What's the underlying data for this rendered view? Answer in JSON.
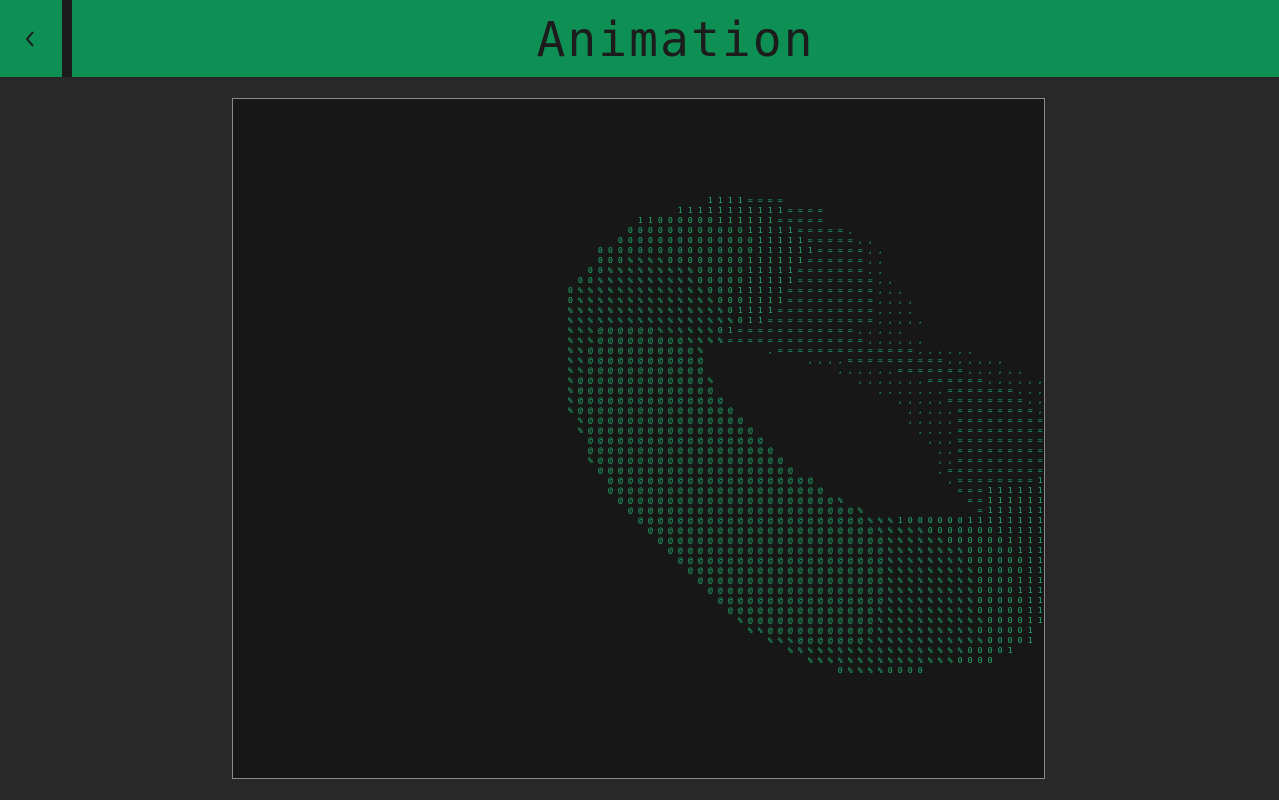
{
  "header": {
    "back_icon": "chevron-left-icon",
    "title": "Animation"
  },
  "colors": {
    "header_bg": "#0e9054",
    "page_bg": "#282828",
    "canvas_bg": "#171717",
    "ascii_fg": "#1fae6a"
  },
  "animation": {
    "frame_lines": [
      "                                          1111====",
      "                                       11111111111====",
      "                                   11000000111111=====",
      "                                  00000000000011111=====,",
      "                                 0000000000000011111=====,,",
      "                               0000000000000000111111=====,,",
      "                               000%%%%00000000111111======,,",
      "                              00%%%%%%%%%0000011111=======,,",
      "                             00%%%%%%%%%%0000011111========,,",
      "                            0%%%%%%%%%%%%%00011111=========,,,",
      "                            0%%%%%%%%%%%%%%0001111=========,,,,",
      "                            %%%%%%%%%%%%%%%%01111==========,,,,",
      "                            %%%%%%%%%%%%%%%%%011===========,,,,,",
      "                            %%%@@@@@@%%%%%%01============,,,,,",
      "                            %%%@@@@@@@@@%%%%==============,,,,,,",
      "                            %%@@@@@@@@@@@%      ,==============,,,,,,",
      "                            %%@@@@@@@@@@@@          ,,,,==========,,,,,,",
      "                            %%@@@@@@@@@@@@             ,,,,,,=======,,,,,,",
      "                            %@@@@@@@@@@@@@%              ,,,,,,,======,,,,,,",
      "                            %@@@@@@@@@@@@@@                ,,,,,,,=======,,,,,",
      "                            %@@@@@@@@@@@@@@@                 ,,,,,========,,,,",
      "                            %@@@@@@@@@@@@@@@@                 ,,,,,========,,,,",
      "                             %@@@@@@@@@@@@@@@@                ,,,,,=========,,,,",
      "                             %@@@@@@@@@@@@@@@@@                ,,,,===========,,",
      "                              @@@@@@@@@@@@@@@@@@                ,,,============,,",
      "                              @@@@@@@@@@@@@@@@@@@                ,,=============,",
      "                              %@@@@@@@@@@@@@@@@@@@               ,,==============,",
      "                               @@@@@@@@@@@@@@@@@@@@              ,===============,",
      "                                @@@@@@@@@@@@@@@@@@@@@             ,========1=======",
      "                                @@@@@@@@@@@@@@@@@@@@@@             ===11111111=====",
      "                                 @@@@@@@@@@@@@@@@@@@@@@%            ==1111111111====",
      "                                  @@@@@@@@@@@@@@@@@@@@@@@%           =1111111111111==",
      "                                   @@@@@@@@@@@@@@@@@@@@@@@%%%1000000111111111=",
      "                                    @@@@@@@@@@@@@@@@@@@@@@@%%%%%000000011111111=",
      "                                     @@@@@@@@@@@@@@@@@@@@@@@%%%%%%0000001111111=",
      "                                      @@@@@@@@@@@@@@@@@@@@@@%%%%%%%%0000011111=",
      "                                       @@@@@@@@@@@@@@@@@@@@@%%%%%%%%0000001111=",
      "                                        @@@@@@@@@@@@@@@@@@@@%%%%%%%%%000001111=",
      "                                         @@@@@@@@@@@@@@@@@@@%%%%%%%%%00001111",
      "                                          @@@@@@@@@@@@@@@@@@%%%%%%%%%0000111",
      "                                           @@@@@@@@@@@@@@@@@%%%%%%%%%00000111",
      "                                            @@@@@@@@@@@@@@@%%%%%%%%%%0000011",
      "                                             %@@@@@@@@@@@@@%%%%%%%%%%%000011",
      "                                              %%@@@@@@@@@@@%%%%%%%%%%000001",
      "                                                %%%@@@@@@@%%%%%%%%%%%%00001",
      "                                                  %%%%%%%%%%%%%%%%%%00001",
      "                                                    %%%%%%%%%%%%%%%0000",
      "                                                       0%%%%0000"
    ]
  }
}
